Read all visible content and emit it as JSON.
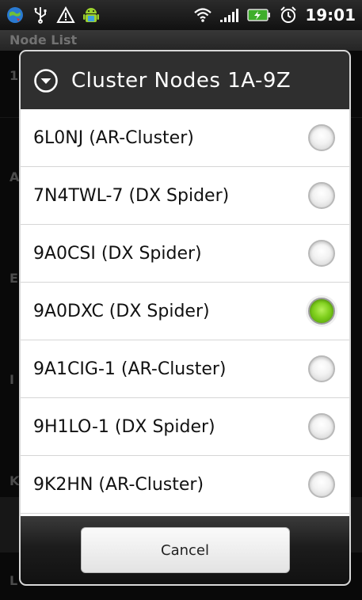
{
  "status_bar": {
    "time": "19:01",
    "left_icons": [
      "globe-icon",
      "usb-icon",
      "warning-icon",
      "android-icon"
    ],
    "right_icons": [
      "wifi-icon",
      "signal-icon",
      "battery-charging-icon",
      "alarm-icon"
    ]
  },
  "background": {
    "header": "Node List",
    "row_letters": [
      "1",
      "A",
      "E",
      "I",
      "K",
      "L"
    ]
  },
  "dialog": {
    "title": "Cluster Nodes 1A-9Z",
    "items": [
      {
        "label": "6L0NJ (AR-Cluster)",
        "selected": false
      },
      {
        "label": "7N4TWL-7 (DX Spider)",
        "selected": false
      },
      {
        "label": "9A0CSI (DX Spider)",
        "selected": false
      },
      {
        "label": "9A0DXC (DX Spider)",
        "selected": true
      },
      {
        "label": "9A1CIG-1 (AR-Cluster)",
        "selected": false
      },
      {
        "label": "9H1LO-1 (DX Spider)",
        "selected": false
      },
      {
        "label": "9K2HN (AR-Cluster)",
        "selected": false
      }
    ],
    "cancel_label": "Cancel"
  },
  "colors": {
    "selected_radio": "#7fcf1d",
    "title_bar": "#2f2f2f"
  }
}
